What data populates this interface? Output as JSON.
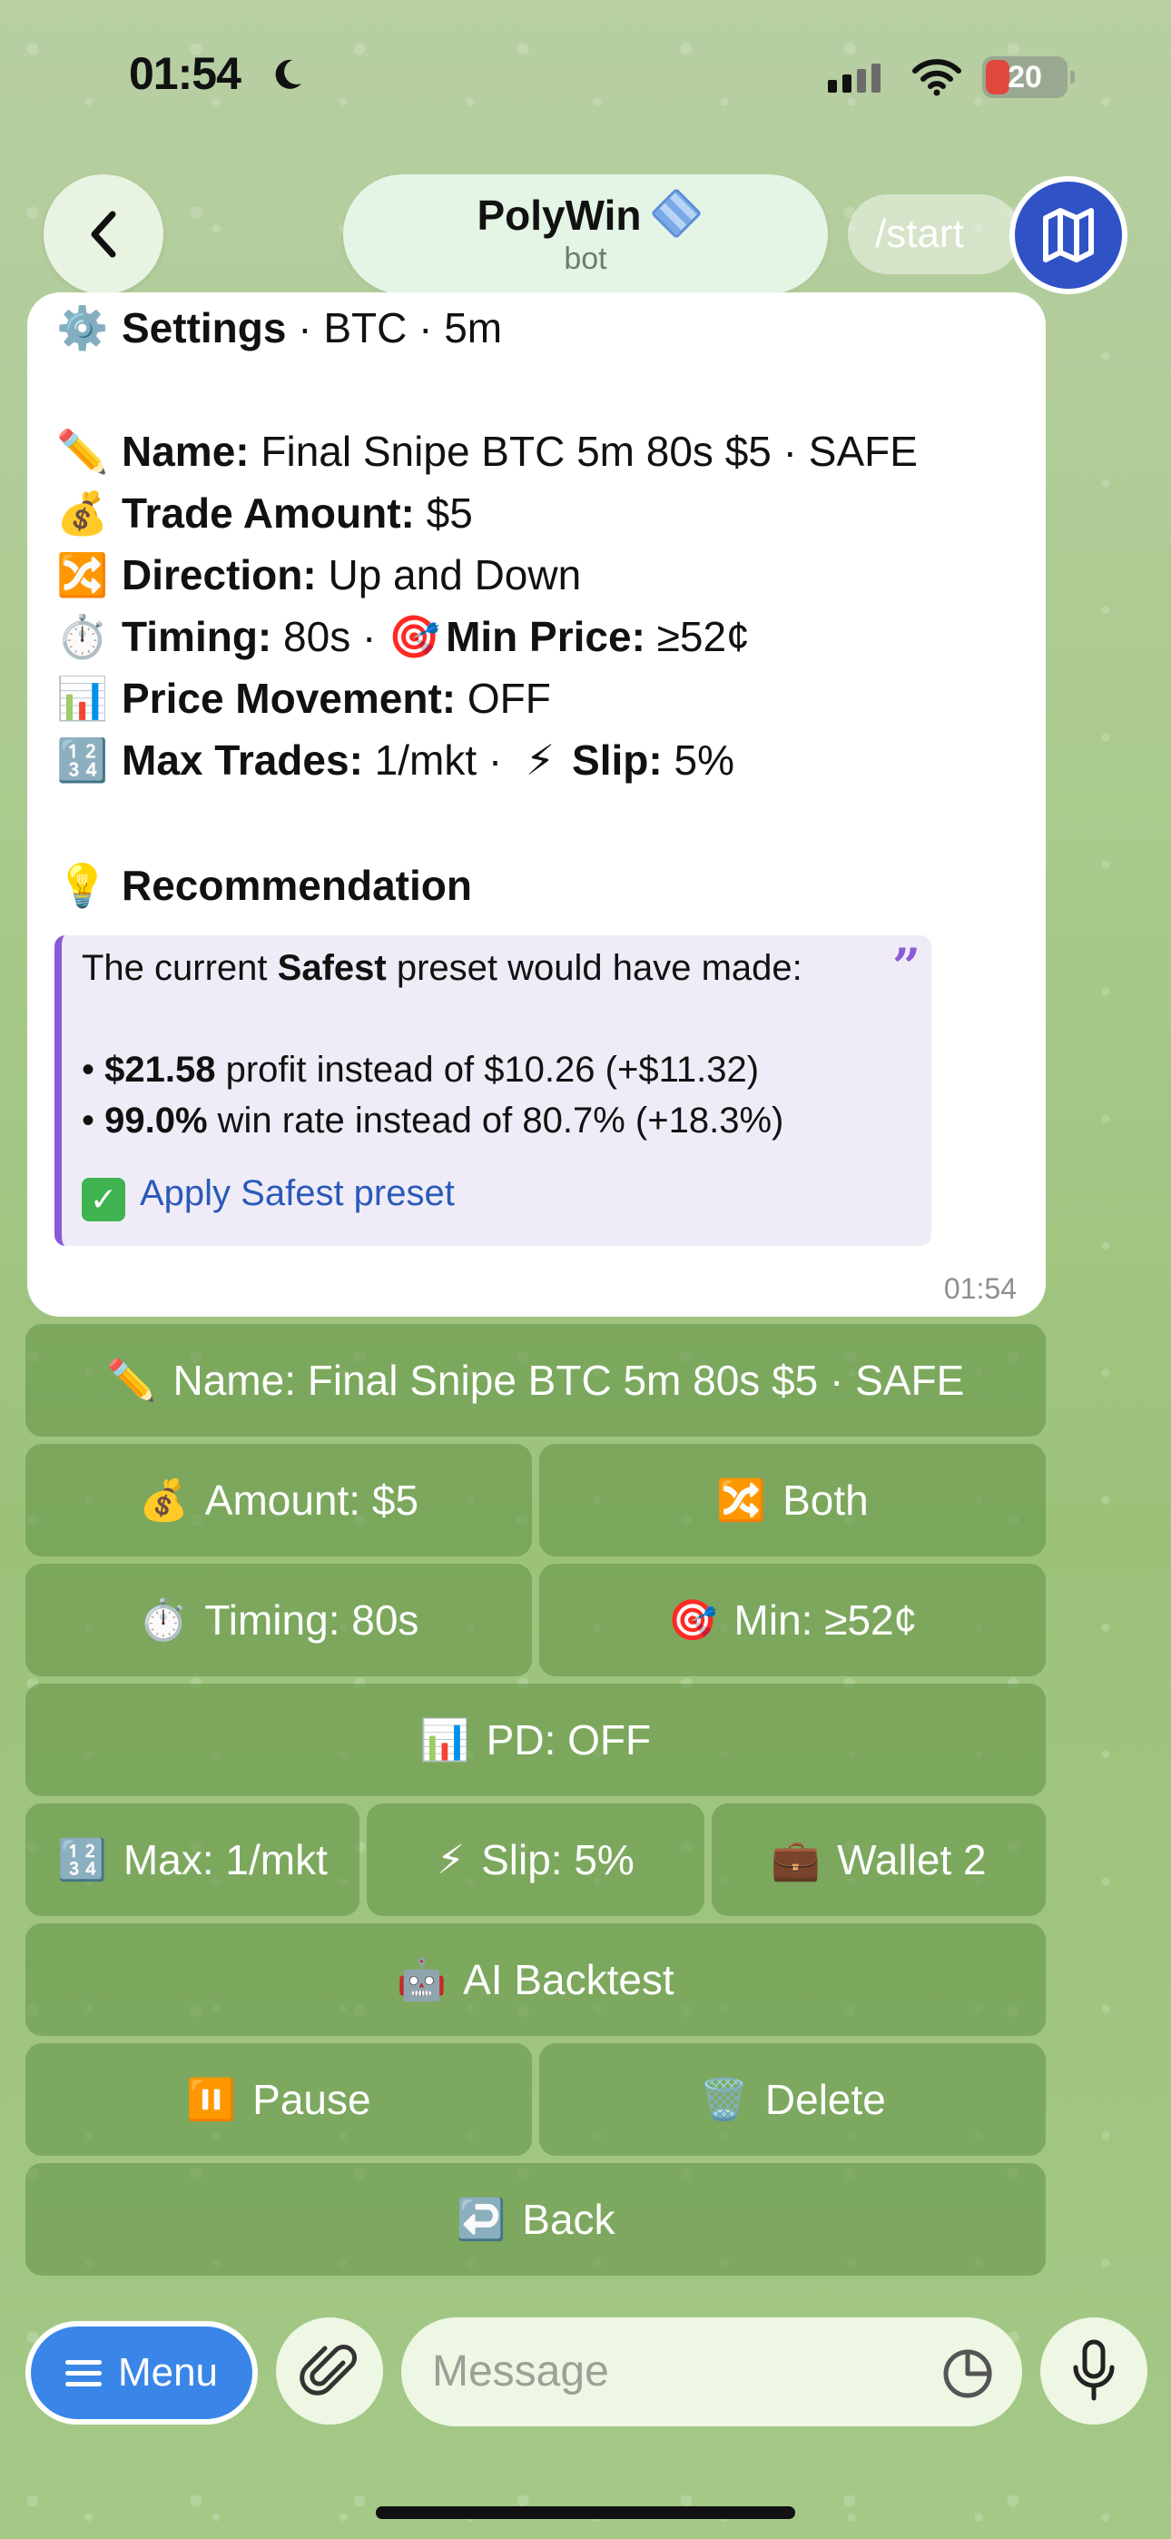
{
  "status_bar": {
    "time": "01:54",
    "battery": "20"
  },
  "header": {
    "back_label": "Back",
    "title": "PolyWin",
    "subtitle": "bot",
    "start_command": "/start"
  },
  "message": {
    "heading": {
      "bold": "Settings",
      "rest": " · BTC · 5m"
    },
    "lines": [
      {
        "label": "Name:",
        "value": " Final Snipe BTC 5m 80s $5 · SAFE"
      },
      {
        "label": "Trade Amount:",
        "value": " $5"
      },
      {
        "label": "Direction:",
        "value": " Up and Down"
      },
      {
        "label": "Timing:",
        "value": " 80s · ",
        "label2": "Min Price:",
        "value2": " ≥52¢"
      },
      {
        "label": "Price Movement:",
        "value": " OFF"
      },
      {
        "label": "Max Trades:",
        "value": " 1/mkt · ",
        "label2": "Slip:",
        "value2": " 5%"
      }
    ],
    "recommendation_title": "Recommendation",
    "quote": {
      "intro_pre": "The current ",
      "intro_bold": "Safest",
      "intro_post": " preset would have made:",
      "bullet1_bold": "$21.58",
      "bullet1_rest": " profit instead of $10.26 (+$11.32)",
      "bullet2_bold": "99.0%",
      "bullet2_rest": " win rate instead of 80.7% (+18.3%)",
      "apply": "Apply Safest preset"
    },
    "time": "01:54"
  },
  "keyboard": {
    "name": "Name: Final Snipe BTC 5m 80s $5 · SAFE",
    "amount": "Amount: $5",
    "direction": "Both",
    "timing": "Timing: 80s",
    "min": "Min: ≥52¢",
    "pd": "PD: OFF",
    "max": "Max: 1/mkt",
    "slip": "Slip: 5%",
    "wallet": "Wallet 2",
    "ai_backtest": "AI Backtest",
    "pause": "Pause",
    "delete": "Delete",
    "back": "Back"
  },
  "input_bar": {
    "menu_label": "Menu",
    "placeholder": "Message"
  },
  "colors": {
    "accent": "#3a86e8",
    "quote_bar": "#8a5bd6",
    "button_bg": "#68964a"
  }
}
